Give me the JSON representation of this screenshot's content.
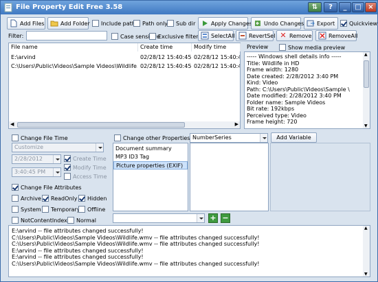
{
  "window": {
    "title": "File Property Edit Free 3.58"
  },
  "toolbar": {
    "add_files": "Add Files",
    "add_folder": "Add Folder",
    "include_path": "Include path",
    "path_only": "Path only",
    "sub_dir": "Sub dir",
    "apply_changes": "Apply Changes",
    "undo_changes": "Undo Changes",
    "export": "Export",
    "quickview": "Quickview"
  },
  "filterbar": {
    "filter_label": "Filter:",
    "case_sensitive": "Case sensitive",
    "exclusive_filter": "Exclusive filter",
    "select_all": "SelectAll",
    "revert_sel": "RevertSel",
    "remove": "Remove",
    "remove_all": "RemoveAll"
  },
  "file_table": {
    "columns": [
      "File name",
      "Create time",
      "Modify time"
    ],
    "rows": [
      {
        "name": "E:\\arvind",
        "create": "02/28/12 15:40:45",
        "modify": "02/28/12 15:40:4"
      },
      {
        "name": "C:\\Users\\Public\\Videos\\Sample Videos\\Wildlife....",
        "create": "02/28/12 15:40:45",
        "modify": "02/28/12 15:40:4"
      }
    ]
  },
  "preview": {
    "label": "Preview",
    "show_media": "Show media preview",
    "lines": [
      "----- Windows shell details info -----",
      "Title: Wildlife in HD",
      "Frame width: 1280",
      "Date created: 2/28/2012 3:40 PM",
      "Kind: Video",
      "Path: C:\\Users\\Public\\Videos\\Sample \\",
      "Date modified: 2/28/2012 3:40 PM",
      "Folder name: Sample Videos",
      "Bit rate: 192kbps",
      "Perceived type: Video",
      "Frame height: 720"
    ]
  },
  "time_panel": {
    "change_file_time": "Change File Time",
    "mode": "Customize",
    "date": "2/28/2012",
    "time": "3:40:45 PM",
    "create_time": "Create Time",
    "modify_time": "Modify Time",
    "access_time": "Access Time"
  },
  "attr_panel": {
    "change_attrs": "Change File Attributes",
    "archive": "Archive",
    "readonly": "ReadOnly",
    "hidden": "Hidden",
    "system": "System",
    "temporary": "Temporary",
    "offline": "Offline",
    "not_content_indexed": "NotContentIndexed",
    "normal": "Normal"
  },
  "props_panel": {
    "change_other": "Change other Properties",
    "series_combo": "NumberSeries",
    "add_variable": "Add Variable",
    "items": [
      "Document summary",
      "MP3 ID3 Tag",
      "Picture properties (EXIF)"
    ]
  },
  "log": {
    "lines": [
      "E:\\arvind -- file attributes changed successfully!",
      "C:\\Users\\Public\\Videos\\Sample Videos\\Wildlife.wmv -- file attributes changed successfully!",
      "C:\\Users\\Public\\Videos\\Sample Videos\\Wildlife.wmv -- file attributes changed successfully!",
      "E:\\arvind -- file attributes changed successfully!",
      "E:\\arvind -- file attributes changed successfully!",
      "C:\\Users\\Public\\Videos\\Sample Videos\\Wildlife.wmv -- file attributes changed successfully!"
    ]
  }
}
